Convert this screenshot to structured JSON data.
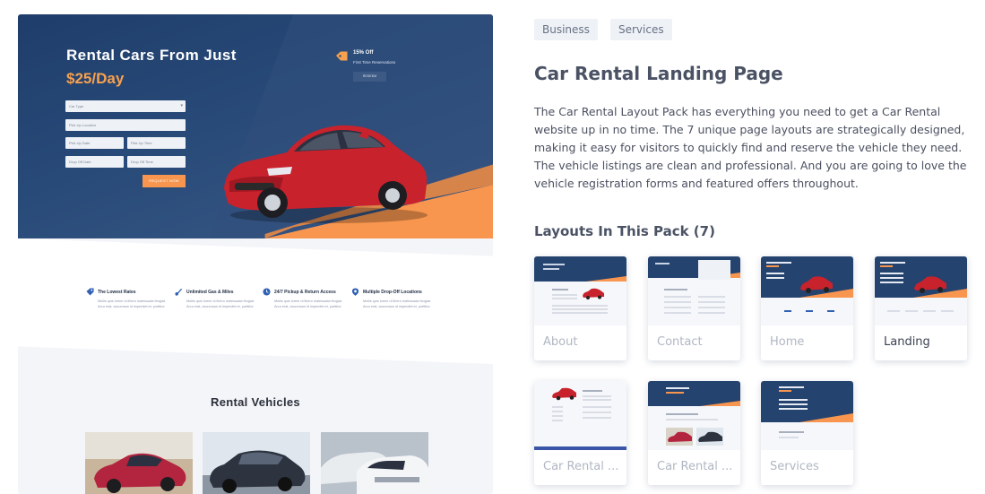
{
  "preview": {
    "hero_title": "Rental Cars From Just",
    "hero_price": "$25/Day",
    "form": {
      "car_type": "Car Type",
      "pickup_location": "Pick Up Location",
      "pickup_date": "Pick Up Date",
      "pickup_time": "Pick Up Time",
      "dropoff_date": "Drop Off Date",
      "dropoff_time": "Drop Off Time",
      "submit": "REQUEST NOW"
    },
    "promo": {
      "title": "15% Off",
      "subtitle": "First Time Reservations",
      "button": "REDEEM"
    },
    "features": [
      {
        "title": "The Lowest Rates",
        "text": "Mollis quis lorem ut libero malesuada feugiat. Arcu erat, accumsan id imperdiet et, porttitor"
      },
      {
        "title": "Unlimited Gas & Miles",
        "text": "Mollis quis lorem ut libero malesuada feugiat. Arcu erat, accumsan id imperdiet et, porttitor"
      },
      {
        "title": "24/7 Pickup & Return Access",
        "text": "Mollis quis lorem ut libero malesuada feugiat. Arcu erat, accumsan id imperdiet et, porttitor"
      },
      {
        "title": "Multiple Drop-Off Locations",
        "text": "Mollis quis lorem ut libero malesuada feugiat. Arcu erat, accumsan id imperdiet et, porttitor"
      }
    ],
    "vehicles_title": "Rental Vehicles",
    "colors": {
      "navy": "#24436f",
      "orange": "#f8964f",
      "car_red": "#c8222d"
    }
  },
  "tags": [
    "Business",
    "Services"
  ],
  "title": "Car Rental Landing Page",
  "description": "The Car Rental Layout Pack has everything you need to get a Car Rental website up in no time. The 7 unique page layouts are strategically designed, making it easy for visitors to quickly find and reserve the vehicle they need. The vehicle listings are clean and professional. And you are going to love the vehicle registration forms and featured offers throughout.",
  "layouts_heading": "Layouts In This Pack (7)",
  "layouts": [
    {
      "label": "About",
      "active": false
    },
    {
      "label": "Contact",
      "active": false
    },
    {
      "label": "Home",
      "active": false
    },
    {
      "label": "Landing",
      "active": true
    },
    {
      "label": "Car Rental ...",
      "active": false
    },
    {
      "label": "Car Rental ...",
      "active": false
    },
    {
      "label": "Services",
      "active": false
    }
  ]
}
